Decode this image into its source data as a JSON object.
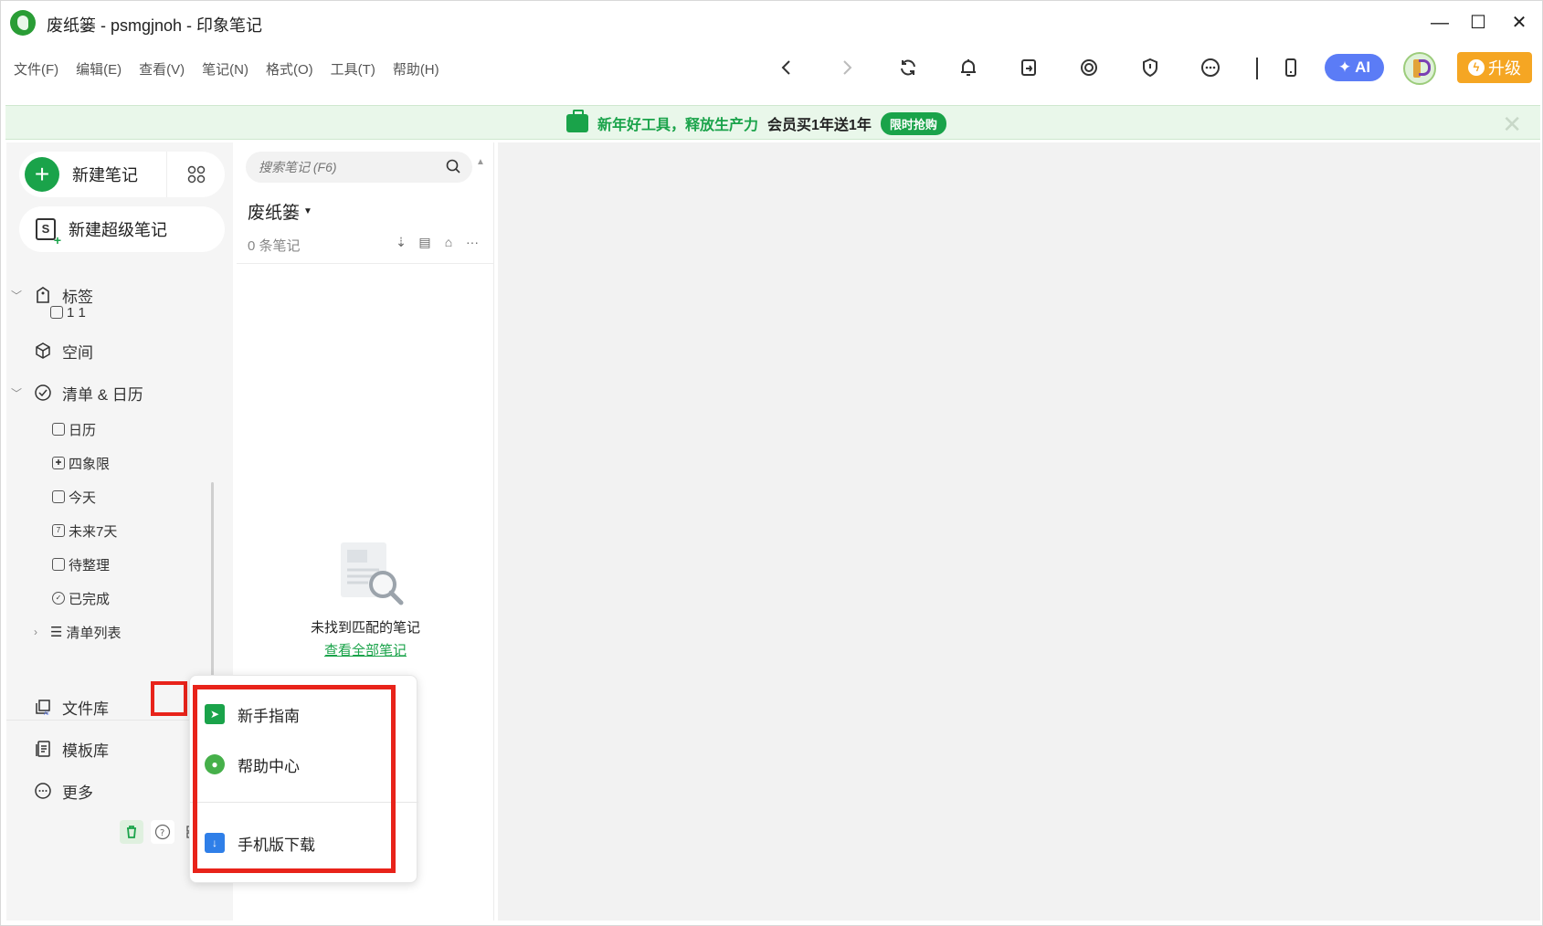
{
  "window": {
    "title": "废纸篓 - psmgjnoh - 印象笔记",
    "controls": {
      "minimize": "—",
      "maximize": "☐",
      "close": "✕"
    }
  },
  "menu": [
    "文件(F)",
    "编辑(E)",
    "查看(V)",
    "笔记(N)",
    "格式(O)",
    "工具(T)",
    "帮助(H)"
  ],
  "toolbar": {
    "icons": [
      "back-icon",
      "forward-icon",
      "sync-icon",
      "bell-icon",
      "share-icon",
      "smile-icon",
      "shield-icon",
      "more-icon",
      "phone-icon"
    ],
    "ai_label": "AI",
    "upgrade_label": "升级"
  },
  "banner": {
    "green_text": "新年好工具，释放生产力",
    "dark_text": "会员买1年送1年",
    "pill": "限时抢购",
    "close": "✕"
  },
  "sidebar": {
    "new_note": "新建笔记",
    "new_super_note": "新建超级笔记",
    "tags": "标签",
    "tag_item": "1  1",
    "space": "空间",
    "todo_calendar": "清单 & 日历",
    "sub_items": [
      "日历",
      "四象限",
      "今天",
      "未来7天",
      "待整理",
      "已完成",
      "清单列表"
    ],
    "file_library": "文件库",
    "template_library": "模板库",
    "more": "更多"
  },
  "notelist": {
    "search_placeholder": "搜索笔记 (F6)",
    "notebook_title": "废纸篓",
    "count": "0 条笔记",
    "empty_text": "未找到匹配的笔记",
    "empty_link": "查看全部笔记"
  },
  "popup": {
    "items": [
      "新手指南",
      "帮助中心",
      "手机版下载"
    ]
  },
  "colors": {
    "brand_green": "#1aa34a",
    "ai_blue": "#5b7cf6",
    "upgrade_orange": "#f5a623",
    "highlight_red": "#e8231a"
  }
}
